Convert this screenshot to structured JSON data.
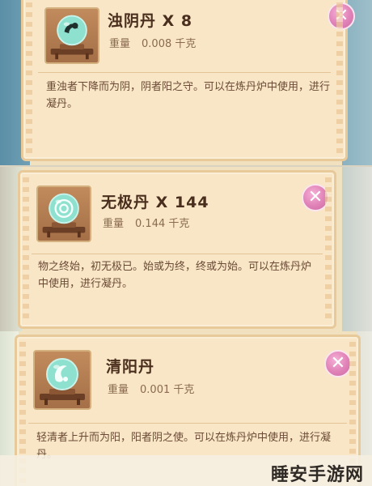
{
  "items": [
    {
      "name": "浊阴丹 X 8",
      "weight_label": "重量",
      "weight_value": "0.008 千克",
      "description": "重浊者下降而为阴，阴者阳之守。可以在炼丹炉中使用，进行凝丹。",
      "close_label": "✕",
      "icon": "dark-pill-icon"
    },
    {
      "name": "无极丹 X 144",
      "weight_label": "重量",
      "weight_value": "0.144 千克",
      "description": "物之终始，初无极已。始或为终，终或为始。可以在炼丹炉中使用，进行凝丹。",
      "close_label": "✕",
      "icon": "spiral-pill-icon"
    },
    {
      "name": "清阳丹",
      "weight_label": "重量",
      "weight_value": "0.001 千克",
      "description": "轻清者上升而为阳，阳者阴之使。可以在炼丹炉中使用，进行凝丹。",
      "close_label": "✕",
      "icon": "light-pill-icon"
    }
  ],
  "watermark": "睡安手游网",
  "colors": {
    "card_bg": "#f8e6c6",
    "title": "#4a2e1d",
    "close_button": "#e081b7",
    "orb": "#7fd6c4"
  }
}
